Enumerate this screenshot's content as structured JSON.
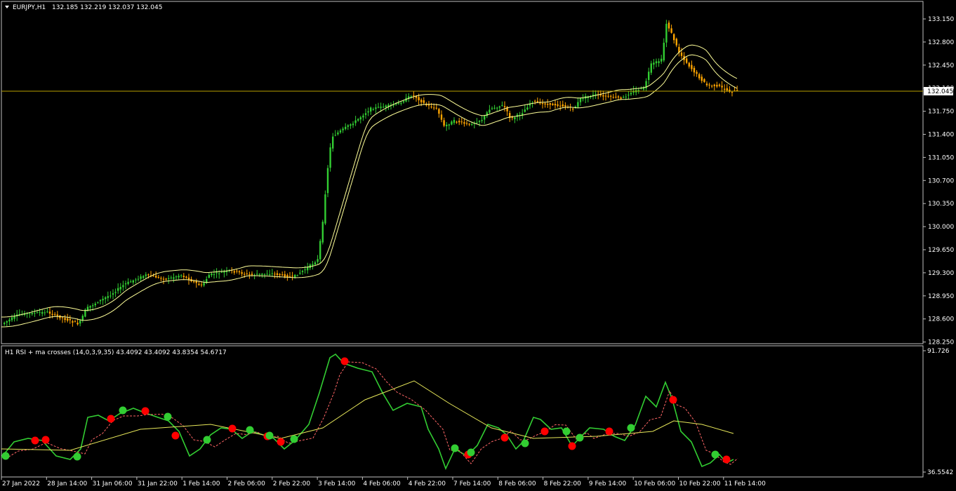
{
  "main_chart": {
    "symbol_label": "EURJPY,H1",
    "ohlc_text": "132.185 132.219 132.037 132.045",
    "current_price": "132.045",
    "price_axis_labels": [
      "133.150",
      "132.800",
      "132.450",
      "132.100",
      "131.750",
      "131.400",
      "131.050",
      "130.700",
      "130.350",
      "130.000",
      "129.650",
      "129.300",
      "128.950",
      "128.600",
      "128.250"
    ]
  },
  "indicator": {
    "label": "H1 RSI + ma crosses (14,0,3,9,35) 43.4092 43.4092 43.8354 54.6717",
    "axis_top": "91.726",
    "axis_bottom": "36.5542"
  },
  "time_axis_labels": [
    "27 Jan 2022",
    "28 Jan 14:00",
    "31 Jan 06:00",
    "31 Jan 22:00",
    "1 Feb 14:00",
    "2 Feb 06:00",
    "2 Feb 22:00",
    "3 Feb 14:00",
    "4 Feb 06:00",
    "4 Feb 22:00",
    "7 Feb 14:00",
    "8 Feb 06:00",
    "8 Feb 22:00",
    "9 Feb 14:00",
    "10 Feb 06:00",
    "10 Feb 22:00",
    "11 Feb 14:00"
  ],
  "colors": {
    "bull_candle": "#32cd32",
    "bear_candle": "#ffa500",
    "envelope_line": "#ffff99",
    "price_line": "#b8a000",
    "rsi_up": "#32cd32",
    "rsi_down": "#ff9966",
    "rsi_signal": "#ff6666",
    "rsi_ma": "#e8e85a",
    "cross_up_dot": "#32cd32",
    "cross_down_dot": "#ff0000",
    "axis_border": "#c0c0c0"
  }
}
